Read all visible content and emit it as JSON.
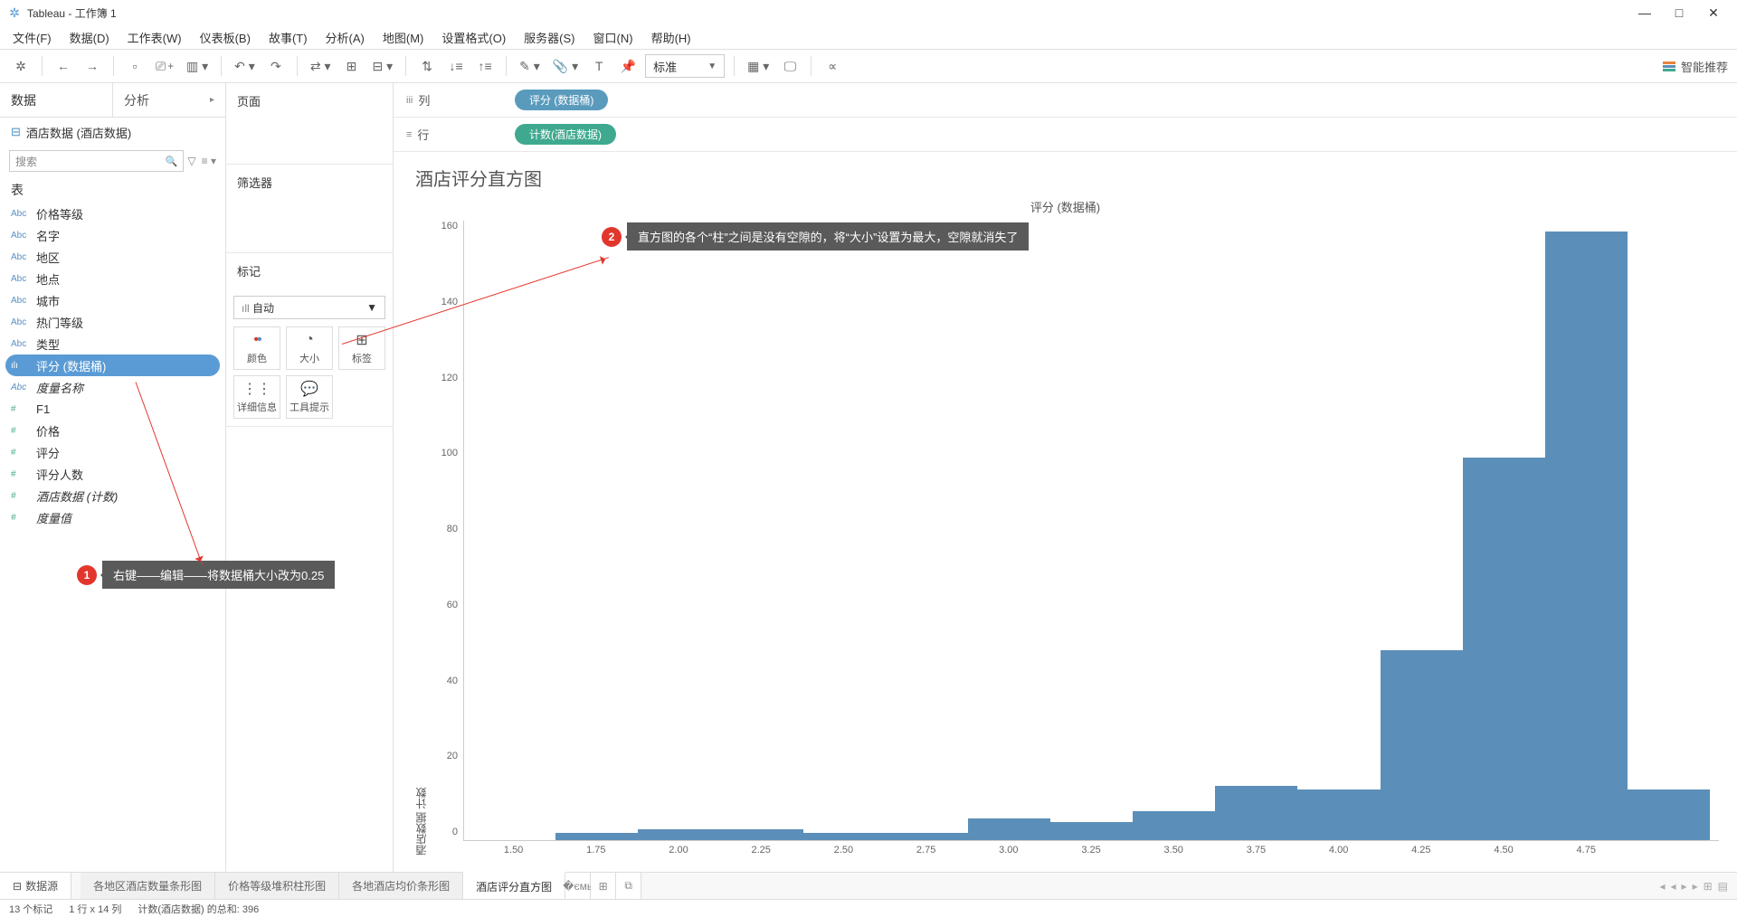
{
  "window": {
    "title": "Tableau - 工作簿 1",
    "minimize": "—",
    "maximize": "□",
    "close": "✕"
  },
  "menu": [
    "文件(F)",
    "数据(D)",
    "工作表(W)",
    "仪表板(B)",
    "故事(T)",
    "分析(A)",
    "地图(M)",
    "设置格式(O)",
    "服务器(S)",
    "窗口(N)",
    "帮助(H)"
  ],
  "toolbar": {
    "fit_dropdown": "标准",
    "smart_recommend": "智能推荐"
  },
  "left": {
    "tabs": {
      "data": "数据",
      "analysis": "分析"
    },
    "datasource": "酒店数据 (酒店数据)",
    "search_placeholder": "搜索",
    "tables_header": "表",
    "fields": [
      {
        "icon": "Abc",
        "type": "dim",
        "label": "价格等级"
      },
      {
        "icon": "Abc",
        "type": "dim",
        "label": "名字"
      },
      {
        "icon": "Abc",
        "type": "dim",
        "label": "地区"
      },
      {
        "icon": "Abc",
        "type": "dim",
        "label": "地点"
      },
      {
        "icon": "Abc",
        "type": "dim",
        "label": "城市"
      },
      {
        "icon": "Abc",
        "type": "dim",
        "label": "热门等级"
      },
      {
        "icon": "Abc",
        "type": "dim",
        "label": "类型"
      },
      {
        "icon": "ılı",
        "type": "dim",
        "label": "评分 (数据桶)",
        "selected": true
      },
      {
        "icon": "Abc",
        "type": "dim",
        "label": "度量名称",
        "italic": true
      },
      {
        "icon": "#",
        "type": "measure",
        "label": "F1"
      },
      {
        "icon": "#",
        "type": "measure",
        "label": "价格"
      },
      {
        "icon": "#",
        "type": "measure",
        "label": "评分"
      },
      {
        "icon": "#",
        "type": "measure",
        "label": "评分人数"
      },
      {
        "icon": "#",
        "type": "measure",
        "label": "酒店数据 (计数)",
        "italic": true
      },
      {
        "icon": "#",
        "type": "measure",
        "label": "度量值",
        "italic": true
      }
    ]
  },
  "mid": {
    "pages": "页面",
    "filters": "筛选器",
    "marks": "标记",
    "mark_type": "自动",
    "cells": {
      "color": "颜色",
      "size": "大小",
      "label": "标签",
      "detail": "详细信息",
      "tooltip": "工具提示"
    }
  },
  "shelves": {
    "columns_label": "列",
    "rows_label": "行",
    "columns_pill": "评分 (数据桶)",
    "rows_pill": "计数(酒店数据)"
  },
  "chart_data": {
    "type": "bar",
    "title": "酒店评分直方图",
    "xlabel": "评分 (数据桶)",
    "ylabel": "酒店数据 计数",
    "categories": [
      "1.50",
      "1.75",
      "2.00",
      "2.25",
      "2.50",
      "2.75",
      "3.00",
      "3.25",
      "3.50",
      "3.75",
      "4.00",
      "4.25",
      "4.50",
      "4.75"
    ],
    "values": [
      0,
      2,
      3,
      3,
      2,
      2,
      6,
      5,
      8,
      15,
      14,
      52,
      105,
      167,
      14
    ],
    "y_ticks": [
      "0",
      "20",
      "40",
      "60",
      "80",
      "100",
      "120",
      "140",
      "160"
    ],
    "ylim": [
      0,
      170
    ]
  },
  "annotations": {
    "anno1": {
      "num": "1",
      "text": "右键——编辑——将数据桶大小改为0.25"
    },
    "anno2": {
      "num": "2",
      "text": "直方图的各个“柱”之间是没有空隙的，将“大小”设置为最大，空隙就消失了"
    }
  },
  "bottom_tabs": {
    "datasource": "数据源",
    "sheets": [
      "各地区酒店数量条形图",
      "价格等级堆积柱形图",
      "各地酒店均价条形图",
      "酒店评分直方图"
    ],
    "active_idx": 3
  },
  "status": {
    "marks": "13 个标记",
    "dims": "1 行 x 14 列",
    "sum": "计数(酒店数据) 的总和: 396"
  }
}
